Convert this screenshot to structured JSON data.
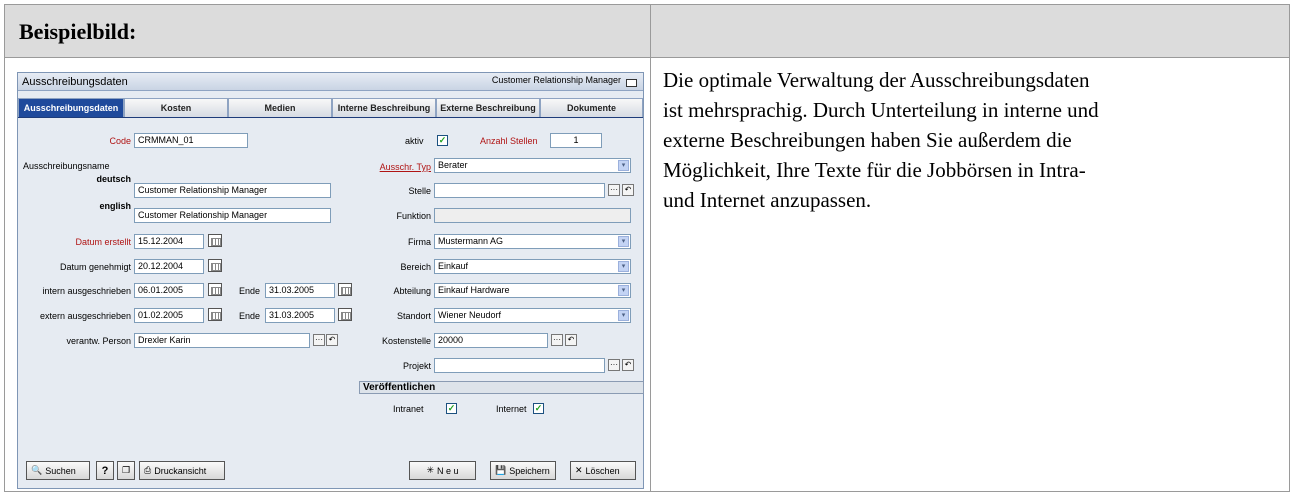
{
  "header": {
    "title": "Beispielbild:"
  },
  "description": {
    "lines": [
      "Die optimale Verwaltung der Ausschreibungsdaten",
      "ist mehrsprachig. Durch Unterteilung in interne und",
      "externe Beschreibungen haben Sie außerdem die",
      "Möglichkeit, Ihre Texte für die Jobbörsen in Intra-",
      "und Internet anzupassen."
    ]
  },
  "app": {
    "title": "Ausschreibungsdaten",
    "subtitle": "Customer Relationship Manager",
    "tabs": [
      "Ausschreibungsdaten",
      "Kosten",
      "Medien",
      "Interne Beschreibung",
      "Externe Beschreibung",
      "Dokumente"
    ],
    "active_tab": "Ausschreibungsdaten",
    "left": {
      "code_label": "Code",
      "code_value": "CRMMAN_01",
      "name_label": "Ausschreibungsname",
      "deutsch_label": "deutsch",
      "deutsch_value": "Customer Relationship Manager",
      "english_label": "english",
      "english_value": "Customer Relationship Manager",
      "erstellt_label": "Datum erstellt",
      "erstellt_value": "15.12.2004",
      "genehmigt_label": "Datum genehmigt",
      "genehmigt_value": "20.12.2004",
      "intern_label": "intern ausgeschrieben",
      "intern_value": "06.01.2005",
      "intern_ende_label": "Ende",
      "intern_ende_value": "31.03.2005",
      "extern_label": "extern ausgeschrieben",
      "extern_value": "01.02.2005",
      "extern_ende_label": "Ende",
      "extern_ende_value": "31.03.2005",
      "person_label": "verantw. Person",
      "person_value": "Drexler Karin"
    },
    "right": {
      "aktiv_label": "aktiv",
      "anzahl_label": "Anzahl Stellen",
      "anzahl_value": "1",
      "typ_label": "Ausschr. Typ",
      "typ_value": "Berater",
      "stelle_label": "Stelle",
      "stelle_value": "",
      "funktion_label": "Funktion",
      "funktion_value": "",
      "firma_label": "Firma",
      "firma_value": "Mustermann AG",
      "bereich_label": "Bereich",
      "bereich_value": "Einkauf",
      "abteilung_label": "Abteilung",
      "abteilung_value": "Einkauf Hardware",
      "standort_label": "Standort",
      "standort_value": "Wiener Neudorf",
      "kostenstelle_label": "Kostenstelle",
      "kostenstelle_value": "20000",
      "projekt_label": "Projekt",
      "projekt_value": "",
      "section_title": "Veröffentlichen",
      "intranet_label": "Intranet",
      "internet_label": "Internet"
    },
    "buttons": {
      "search": "Suchen",
      "help": "?",
      "print": "Druckansicht",
      "new": "N e u",
      "save": "Speichern",
      "delete": "Löschen"
    },
    "glyphs": {
      "check": "✓",
      "dropdown": "▾",
      "dots": "···",
      "back": "↶",
      "new_star": "✳",
      "cross": "✕"
    }
  }
}
